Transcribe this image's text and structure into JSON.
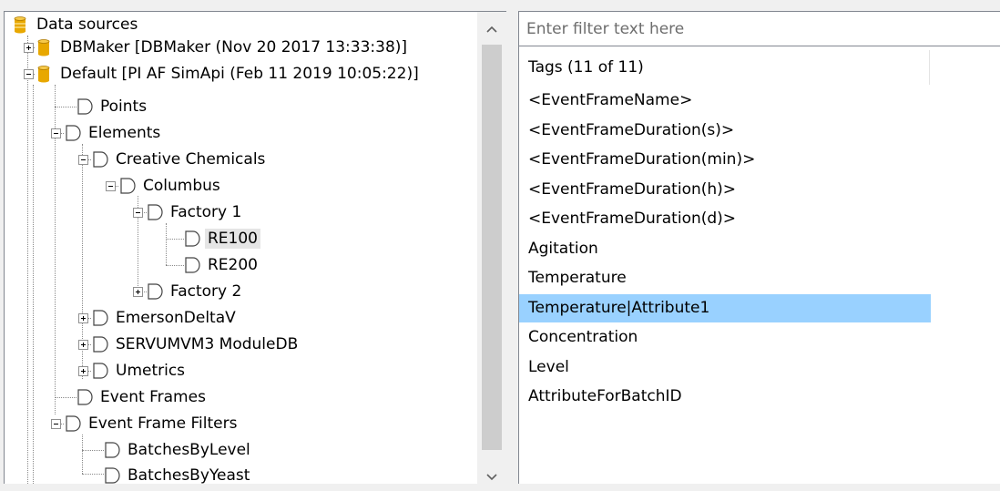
{
  "tree": {
    "root_label": "Data sources",
    "nodes": [
      {
        "label": "DBMaker [DBMaker (Nov 20 2017 13:33:38)]",
        "icon": "database-icon",
        "expander": "plus"
      },
      {
        "label": "Default [PI AF SimApi (Feb 11 2019 10:05:22)]",
        "icon": "database-icon",
        "expander": "minus"
      },
      {
        "label": "Points",
        "icon": "element-icon",
        "expander": "none"
      },
      {
        "label": "Elements",
        "icon": "element-icon",
        "expander": "minus"
      },
      {
        "label": "Creative Chemicals",
        "icon": "element-icon",
        "expander": "minus"
      },
      {
        "label": "Columbus",
        "icon": "element-icon",
        "expander": "minus"
      },
      {
        "label": "Factory 1",
        "icon": "element-icon",
        "expander": "minus"
      },
      {
        "label": "RE100",
        "icon": "element-icon",
        "expander": "none",
        "selected": true
      },
      {
        "label": "RE200",
        "icon": "element-icon",
        "expander": "none"
      },
      {
        "label": "Factory 2",
        "icon": "element-icon",
        "expander": "plus"
      },
      {
        "label": "EmersonDeltaV",
        "icon": "element-icon",
        "expander": "plus"
      },
      {
        "label": "SERVUMVM3 ModuleDB",
        "icon": "element-icon",
        "expander": "plus"
      },
      {
        "label": "Umetrics",
        "icon": "element-icon",
        "expander": "plus"
      },
      {
        "label": "Event Frames",
        "icon": "element-icon",
        "expander": "none"
      },
      {
        "label": "Event Frame Filters",
        "icon": "element-icon",
        "expander": "minus"
      },
      {
        "label": "BatchesByLevel",
        "icon": "element-icon",
        "expander": "none"
      },
      {
        "label": "BatchesByYeast",
        "icon": "element-icon",
        "expander": "none"
      }
    ]
  },
  "scrollbar": {
    "up_icon": "chevron-up-icon",
    "down_icon": "chevron-down-icon"
  },
  "filter": {
    "placeholder": "Enter filter text here",
    "value": ""
  },
  "tags": {
    "header": "Tags (11 of 11)",
    "items": [
      "<EventFrameName>",
      "<EventFrameDuration(s)>",
      "<EventFrameDuration(min)>",
      "<EventFrameDuration(h)>",
      "<EventFrameDuration(d)>",
      "Agitation",
      "Temperature",
      "Temperature|Attribute1",
      "Concentration",
      "Level",
      "AttributeForBatchID"
    ],
    "selected_index": 7
  },
  "colors": {
    "selection": "#99d1ff",
    "database": "#e8a800",
    "pane_border": "#828790"
  }
}
